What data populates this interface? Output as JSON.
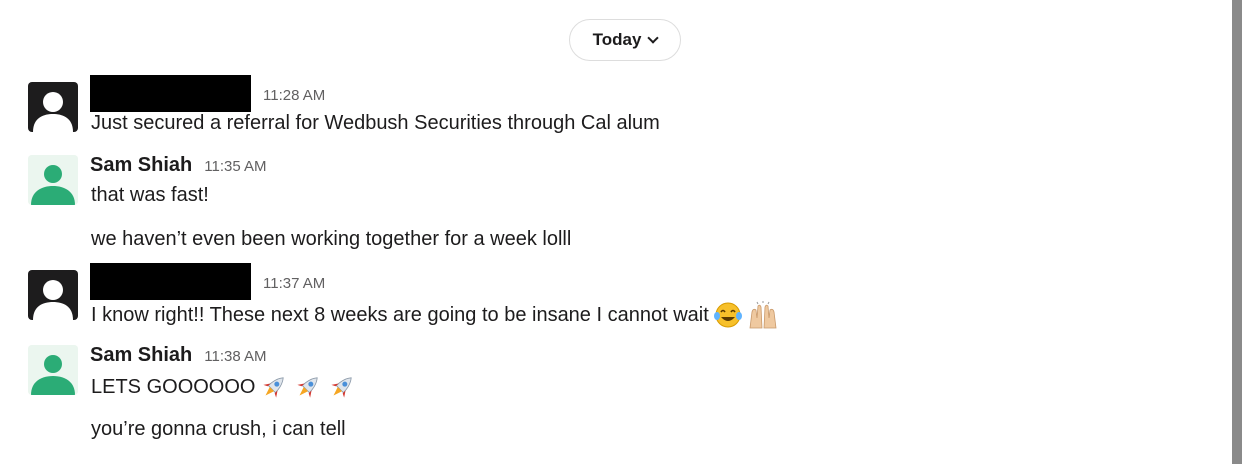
{
  "divider": {
    "label": "Today"
  },
  "messages": [
    {
      "author": "",
      "time": "11:28 AM",
      "lines": [
        "Just secured a referral for Wedbush Securities through Cal alum"
      ]
    },
    {
      "author": "Sam Shiah",
      "time": "11:35 AM",
      "lines": [
        "that was fast!",
        "we haven’t even been working together for a week lolll"
      ]
    },
    {
      "author": "",
      "time": "11:37 AM",
      "lines": [
        "I know right!! These next 8 weeks are going to be insane I cannot wait"
      ],
      "emojis": [
        "joy-emoji",
        "raised-hands-emoji"
      ]
    },
    {
      "author": "Sam Shiah",
      "time": "11:38 AM",
      "lines": [
        "LETS GOOOOOO",
        "you’re gonna crush, i can tell"
      ],
      "emojis": [
        "rocket-emoji",
        "rocket-emoji",
        "rocket-emoji"
      ]
    }
  ],
  "colors": {
    "avatar_dark": "#1d1c1d",
    "avatar_green": "#2bac76",
    "timestamp": "#616061",
    "scrollbar": "#8a8a8a"
  }
}
